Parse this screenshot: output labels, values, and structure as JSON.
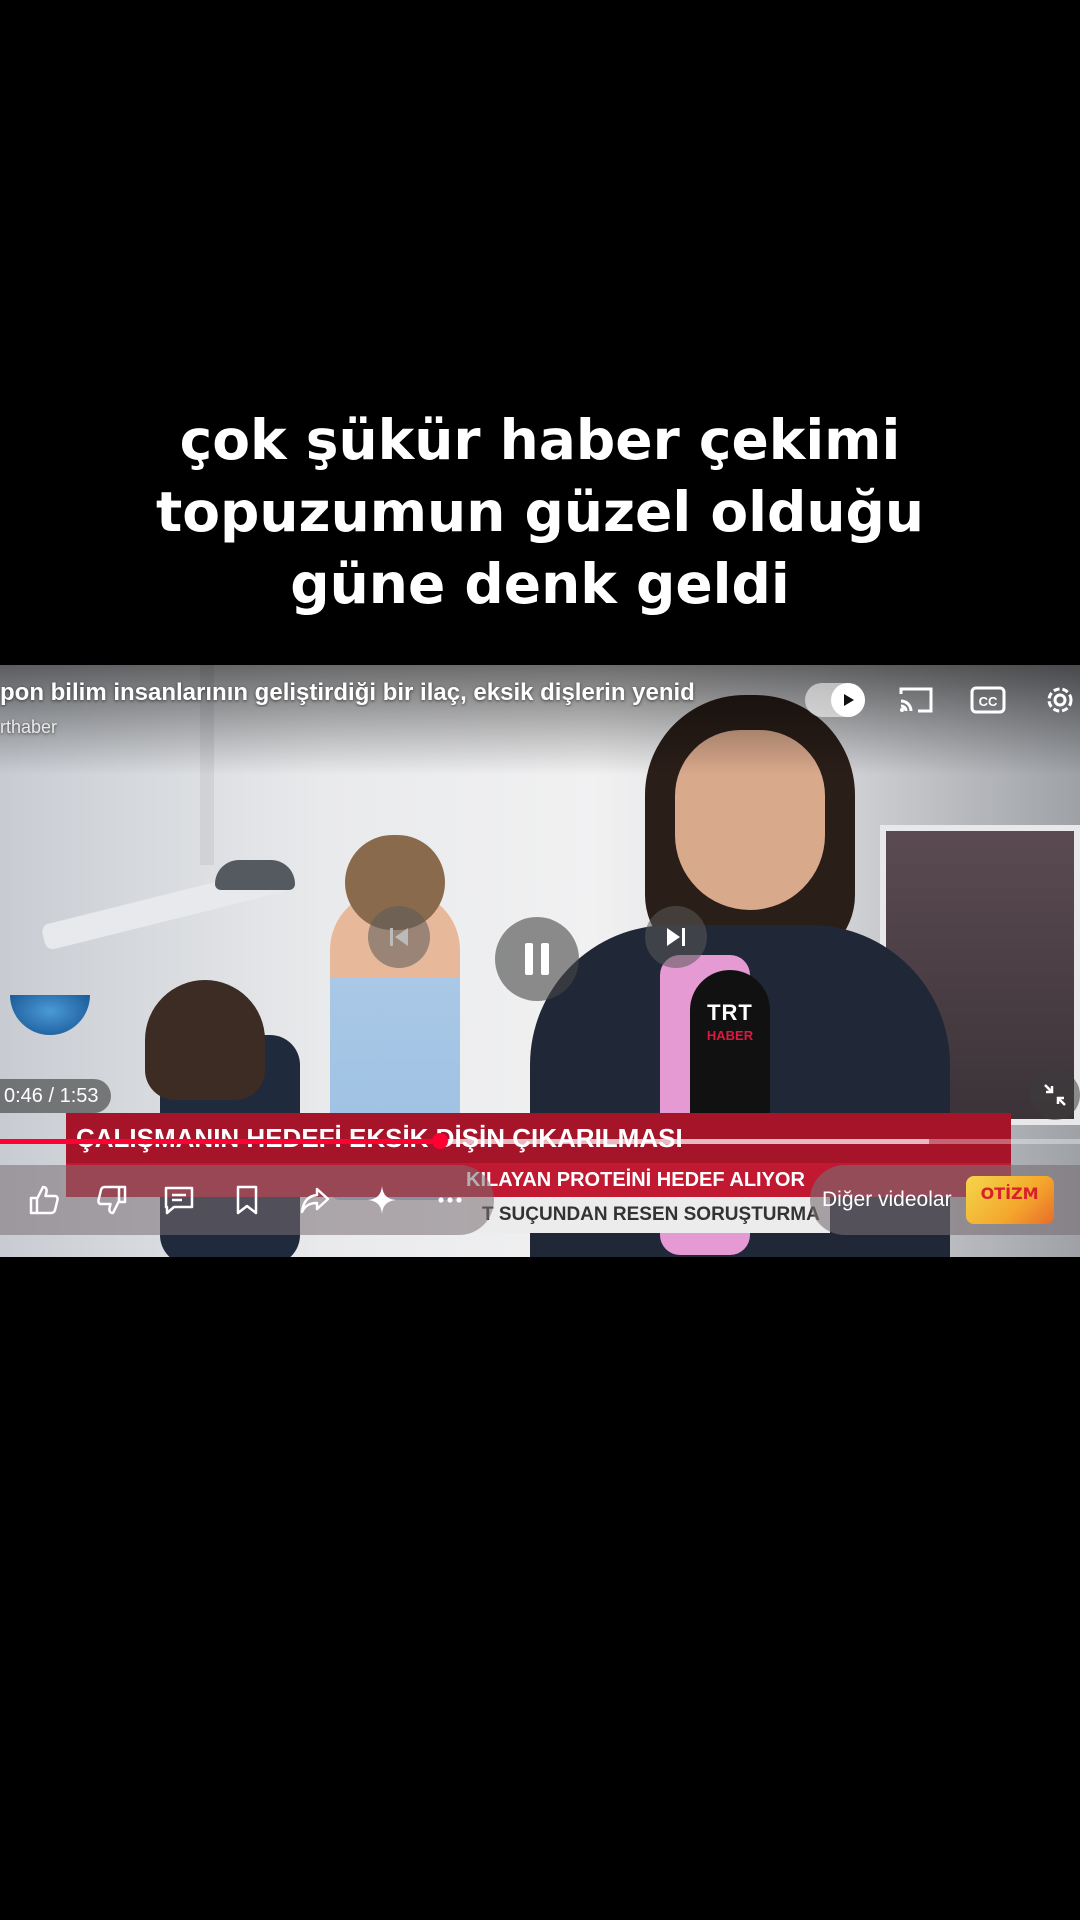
{
  "caption": {
    "line1": "çok şükür haber çekimi",
    "line2": "topuzumun güzel olduğu",
    "line3": "güne denk geldi"
  },
  "player": {
    "title": "pon bilim insanlarının geliştirdiği bir ilaç, eksik dişlerin yenid",
    "channel": "rthaber",
    "time": "0:46 / 1:53",
    "progress": 0.407,
    "buffered": 0.86,
    "more_videos_label": "Diğer videolar",
    "more_videos_thumb_text": "OTİZM"
  },
  "video_frame": {
    "mic_logo": "TRT",
    "mic_logo_sub": "HABER",
    "lower_third_main": "ÇALIŞMANIN HEDEFİ EKSİK DİŞİN ÇIKARILMASI",
    "lower_third_sub": "KILAYAN PROTEİNİ HEDEF ALIYOR",
    "ticker": "T SUÇUNDAN RESEN SORUŞTURMA"
  },
  "colors": {
    "progress": "#ff0033",
    "lower_third": "#a6142a"
  },
  "icons": [
    "autoplay-toggle-icon",
    "cast-icon",
    "captions-icon",
    "settings-icon",
    "previous-icon",
    "pause-icon",
    "next-icon",
    "minimize-icon",
    "like-icon",
    "dislike-icon",
    "comments-icon",
    "save-icon",
    "share-icon",
    "ask-icon",
    "more-icon"
  ]
}
